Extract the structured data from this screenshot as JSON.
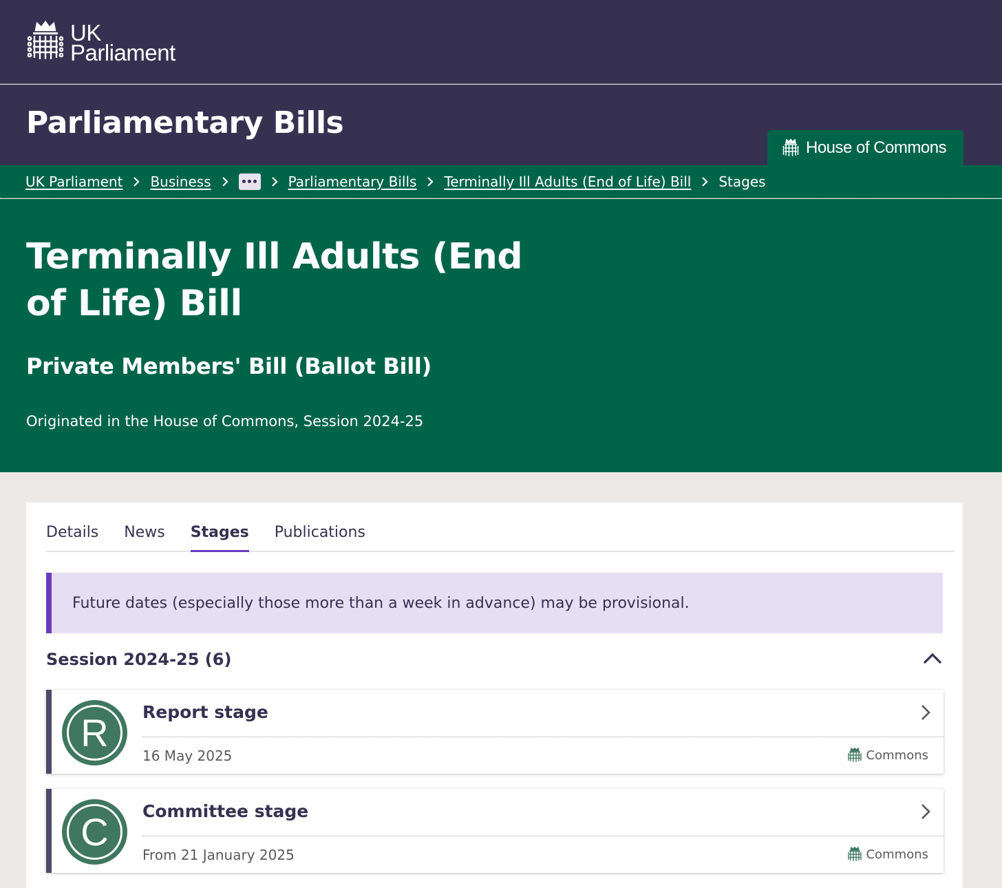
{
  "header": {
    "logo_line1": "UK",
    "logo_line2": "Parliament",
    "section_title": "Parliamentary Bills",
    "house_tab": "House of Commons"
  },
  "breadcrumb": {
    "items": [
      "UK Parliament",
      "Business",
      "Parliamentary Bills",
      "Terminally Ill Adults (End of Life) Bill"
    ],
    "current": "Stages"
  },
  "bill": {
    "title": "Terminally Ill Adults (End of Life) Bill",
    "type": "Private Members' Bill (Ballot Bill)",
    "origin": "Originated in the House of Commons, Session 2024-25"
  },
  "tabs": [
    "Details",
    "News",
    "Stages",
    "Publications"
  ],
  "active_tab": "Stages",
  "notice": "Future dates (especially those more than a week in advance) may be provisional.",
  "session": {
    "title": "Session 2024-25 (6)",
    "stages": [
      {
        "letter": "R",
        "title": "Report stage",
        "date": "16 May 2025",
        "house": "Commons"
      },
      {
        "letter": "C",
        "title": "Committee stage",
        "date": "From 21 January 2025",
        "house": "Commons"
      }
    ]
  },
  "colors": {
    "header_purple": "#373151",
    "commons_green": "#006548",
    "accent_purple": "#6a3bbd",
    "badge_green": "#3f7760"
  },
  "icons": [
    "portcullis-icon",
    "chevron-right-icon",
    "chevron-up-icon",
    "ellipsis-icon"
  ]
}
